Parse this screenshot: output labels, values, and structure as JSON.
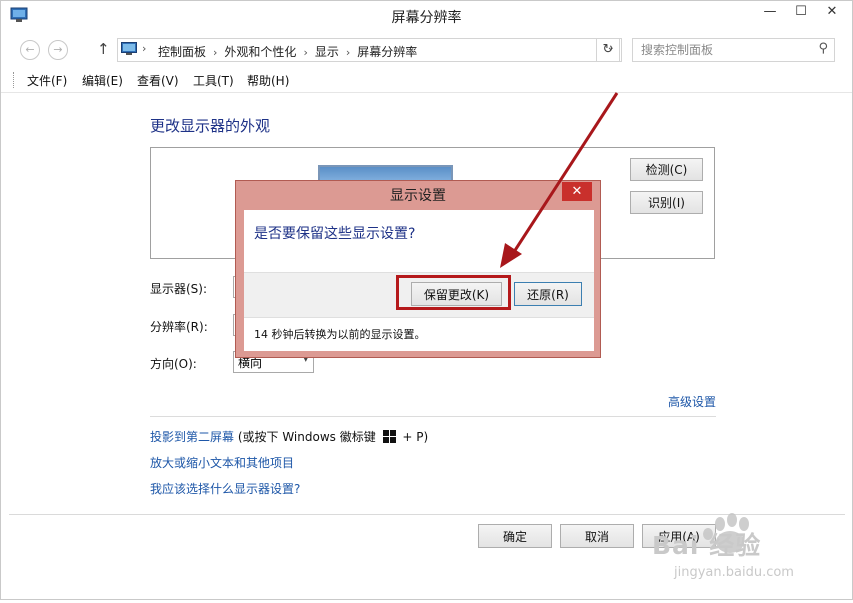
{
  "window": {
    "title": "屏幕分辨率",
    "controls": {
      "minimize": "—",
      "maximize": "☐",
      "close": "✕"
    }
  },
  "address": {
    "back": "←",
    "forward": "→",
    "up": "↑",
    "breadcrumb": [
      "控制面板",
      "外观和个性化",
      "显示",
      "屏幕分辨率"
    ],
    "separator": "›",
    "dropdown": "⌄",
    "refresh": "↻",
    "search_placeholder": "搜索控制面板",
    "search_icon": "⚲"
  },
  "menu": [
    "文件(F)",
    "编辑(E)",
    "查看(V)",
    "工具(T)",
    "帮助(H)"
  ],
  "main": {
    "heading": "更改显示器的外观",
    "detect_button": "检测(C)",
    "identify_button": "识别(I)",
    "display_label": "显示器(S):",
    "resolution_label": "分辨率(R):",
    "orientation_label": "方向(O):",
    "orientation_value": "横向",
    "select_arrow": "▾",
    "advanced_link": "高级设置",
    "project_link": "投影到第二屏幕",
    "project_hint_prefix": " (或按下 Windows 徽标键 ",
    "project_hint_suffix": " + P)",
    "text_size_link": "放大或缩小文本和其他项目",
    "which_settings_link": "我应该选择什么显示器设置?"
  },
  "footer": {
    "ok": "确定",
    "cancel": "取消",
    "apply": "应用(A)"
  },
  "dialog": {
    "title": "显示设置",
    "close": "✕",
    "question": "是否要保留这些显示设置?",
    "keep_button": "保留更改(K)",
    "revert_button": "还原(R)",
    "countdown": "14 秒钟后转换为以前的显示设置。"
  },
  "watermark": {
    "brand": "Bai  经验",
    "url": "jingyan.baidu.com"
  },
  "colors": {
    "accent_text": "#1e3287",
    "link": "#1e57a8",
    "dialog_frame": "#dc9a93",
    "highlight": "#b5191b"
  }
}
